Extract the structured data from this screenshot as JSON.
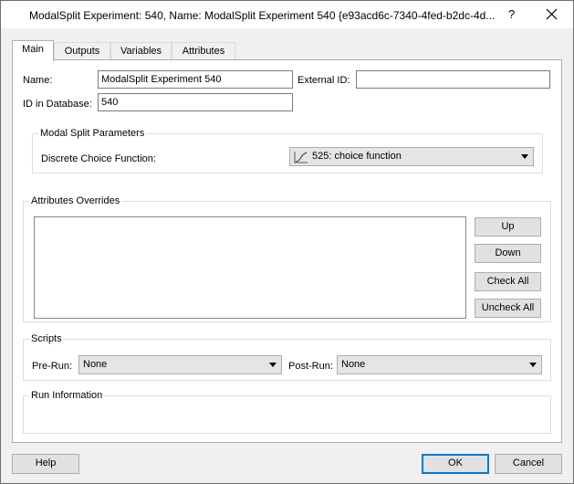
{
  "window": {
    "title": "ModalSplit Experiment: 540, Name: ModalSplit Experiment 540  {e93acd6c-7340-4fed-b2dc-4d...",
    "help_glyph": "?"
  },
  "tabs": [
    {
      "label": "Main"
    },
    {
      "label": "Outputs"
    },
    {
      "label": "Variables"
    },
    {
      "label": "Attributes"
    }
  ],
  "main": {
    "name_label": "Name:",
    "name_value": "ModalSplit Experiment 540",
    "external_id_label": "External ID:",
    "external_id_value": "",
    "db_id_label": "ID in Database:",
    "db_id_value": "540"
  },
  "modal_split": {
    "title": "Modal Split Parameters",
    "dcf_label": "Discrete Choice Function:",
    "dcf_value": "525: choice function"
  },
  "overrides": {
    "title": "Attributes Overrides",
    "buttons": {
      "up": "Up",
      "down": "Down",
      "check_all": "Check All",
      "uncheck_all": "Uncheck All"
    }
  },
  "scripts": {
    "title": "Scripts",
    "pre_run_label": "Pre-Run:",
    "pre_run_value": "None",
    "post_run_label": "Post-Run:",
    "post_run_value": "None"
  },
  "run_info": {
    "title": "Run Information"
  },
  "footer": {
    "help": "Help",
    "ok": "OK",
    "cancel": "Cancel"
  }
}
